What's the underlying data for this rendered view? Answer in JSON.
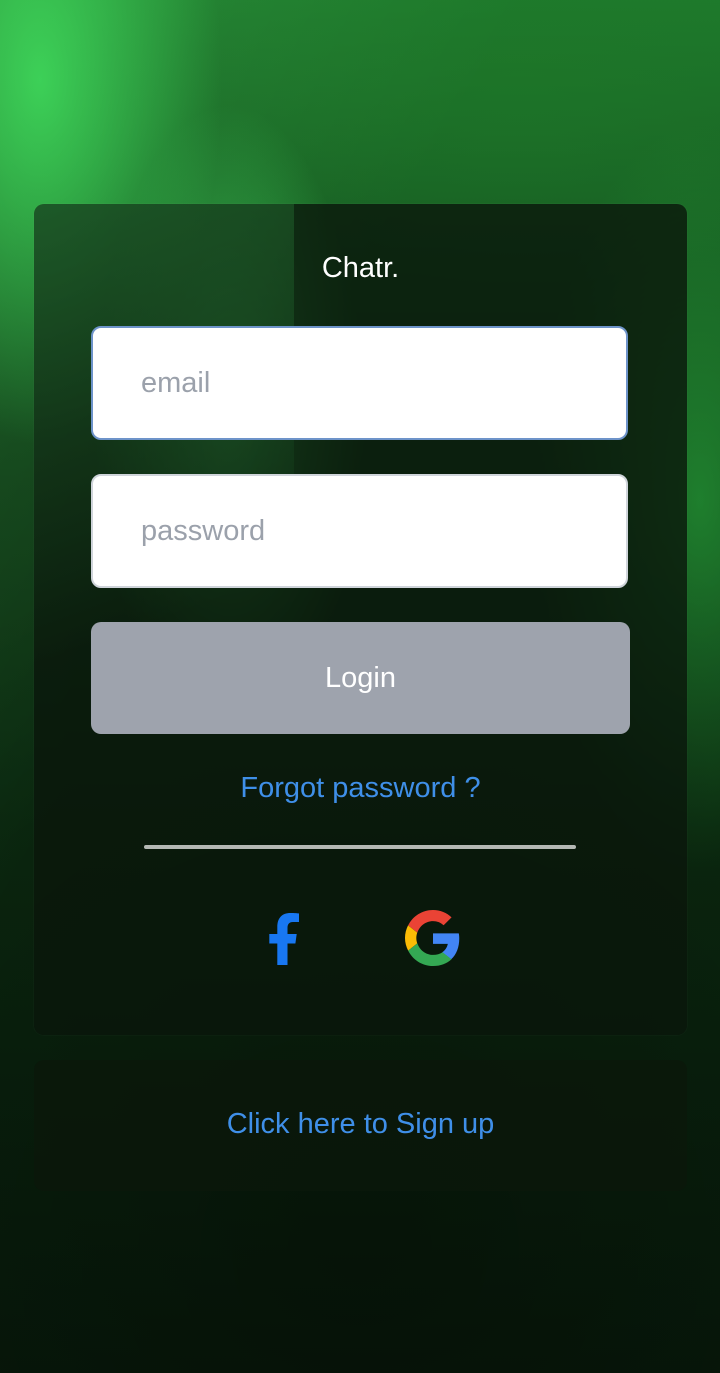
{
  "app": {
    "title": "Chatr."
  },
  "login_form": {
    "email_placeholder": "email",
    "password_placeholder": "password",
    "login_label": "Login",
    "forgot_password_label": "Forgot password ?"
  },
  "social_login": {
    "facebook_icon": "facebook-icon",
    "google_icon": "google-icon"
  },
  "signup": {
    "label": "Click here to Sign up"
  },
  "colors": {
    "link": "#3f8fe8",
    "login_button": "#9ea3ad",
    "facebook": "#1877f2"
  }
}
